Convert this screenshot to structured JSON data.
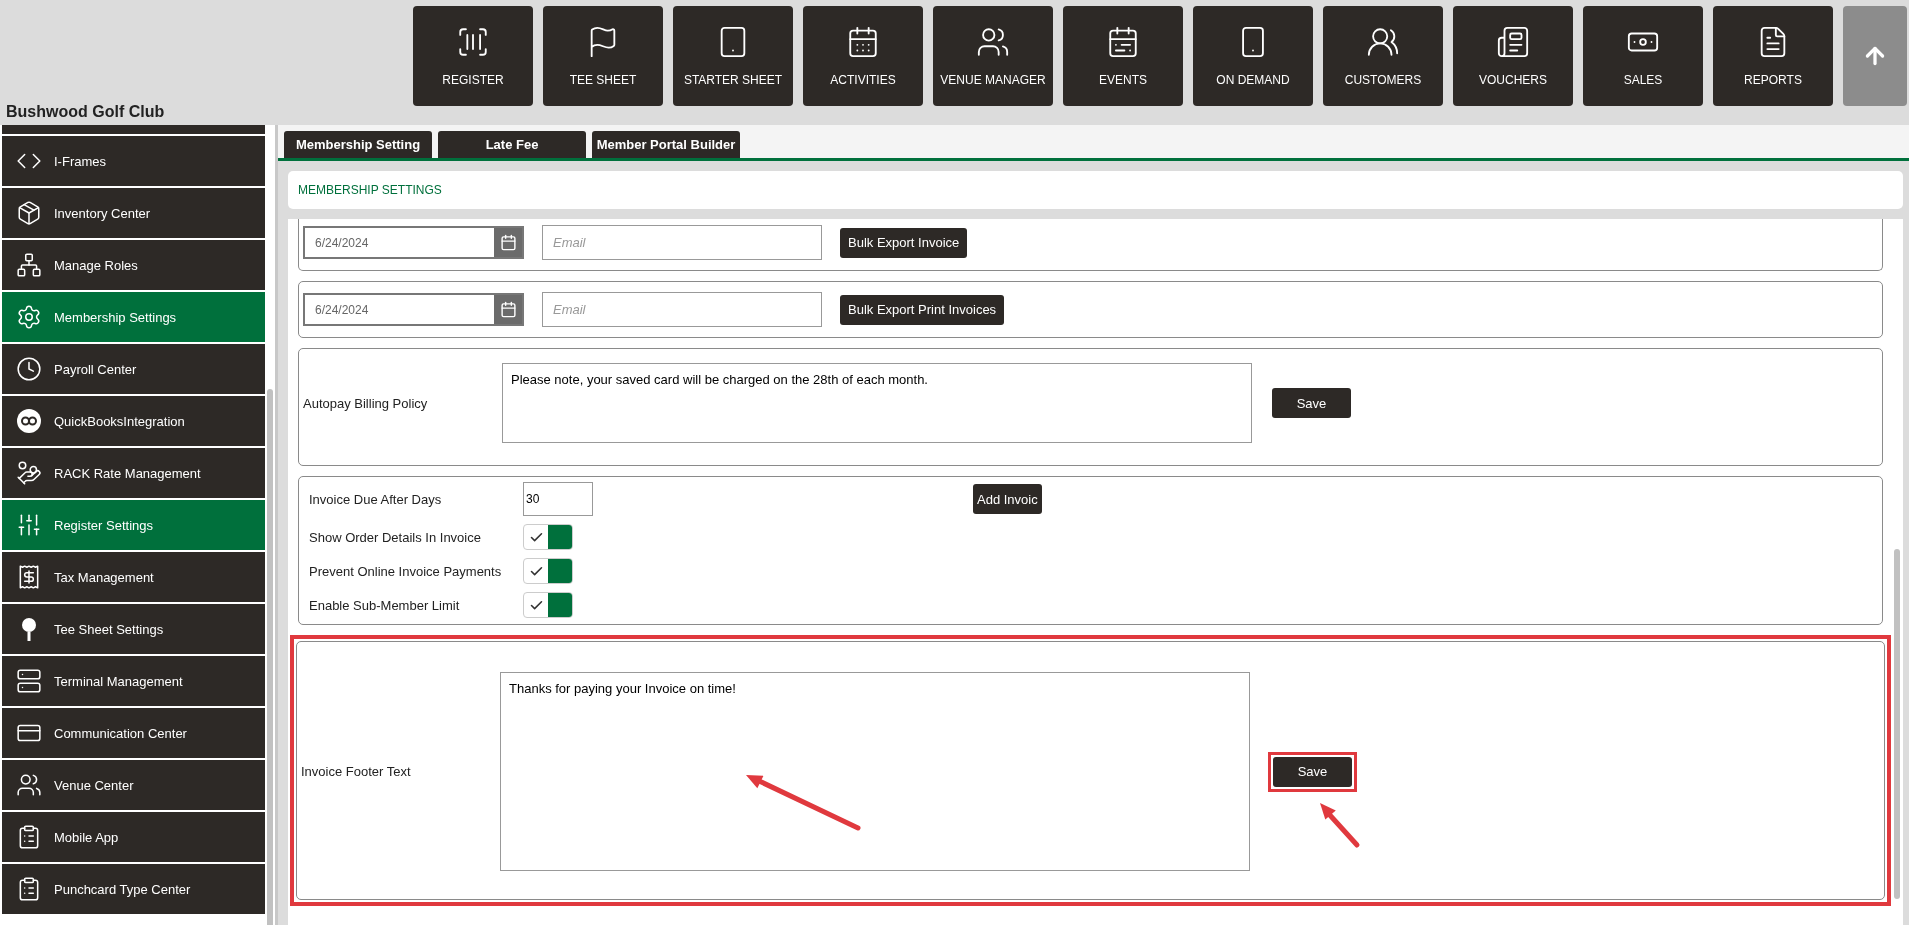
{
  "nav": [
    {
      "label": "REGISTER"
    },
    {
      "label": "TEE SHEET"
    },
    {
      "label": "STARTER SHEET"
    },
    {
      "label": "ACTIVITIES"
    },
    {
      "label": "VENUE MANAGER"
    },
    {
      "label": "EVENTS"
    },
    {
      "label": "ON DEMAND"
    },
    {
      "label": "CUSTOMERS"
    },
    {
      "label": "VOUCHERS"
    },
    {
      "label": "SALES"
    },
    {
      "label": "REPORTS"
    }
  ],
  "club_name": "Bushwood Golf Club",
  "sidebar": {
    "items": [
      {
        "label": "I-Frames",
        "selected": false
      },
      {
        "label": "Inventory Center",
        "selected": false
      },
      {
        "label": "Manage Roles",
        "selected": false
      },
      {
        "label": "Membership Settings",
        "selected": true
      },
      {
        "label": "Payroll Center",
        "selected": false
      },
      {
        "label": "QuickBooksIntegration",
        "selected": false
      },
      {
        "label": "RACK Rate Management",
        "selected": false
      },
      {
        "label": "Register Settings",
        "selected": true
      },
      {
        "label": "Tax Management",
        "selected": false
      },
      {
        "label": "Tee Sheet Settings",
        "selected": false
      },
      {
        "label": "Terminal Management",
        "selected": false
      },
      {
        "label": "Communication Center",
        "selected": false
      },
      {
        "label": "Venue Center",
        "selected": false
      },
      {
        "label": "Mobile App",
        "selected": false
      },
      {
        "label": "Punchcard Type Center",
        "selected": false
      }
    ]
  },
  "tabs": [
    {
      "label": "Membership Setting"
    },
    {
      "label": "Late Fee"
    },
    {
      "label": "Member Portal Builder"
    }
  ],
  "panel_title": "MEMBERSHIP SETTINGS",
  "export_rows": [
    {
      "date": "6/24/2024",
      "email": {
        "placeholder": "Email"
      },
      "button": "Bulk Export Invoice"
    },
    {
      "date": "6/24/2024",
      "email": {
        "placeholder": "Email"
      },
      "button": "Bulk Export Print Invoices"
    }
  ],
  "autopay": {
    "label": "Autopay Billing Policy",
    "text": "Please note, your saved card will be charged on the 28th of each month.",
    "button": "Save"
  },
  "invoice_settings": {
    "due_label": "Invoice Due After Days",
    "due_value": "30",
    "add_button": "Add Invoic",
    "toggles": [
      {
        "label": "Show Order Details In Invoice",
        "on": true
      },
      {
        "label": "Prevent Online Invoice Payments",
        "on": true
      },
      {
        "label": "Enable Sub-Member Limit",
        "on": true
      }
    ]
  },
  "footer": {
    "label": "Invoice Footer Text",
    "text": "Thanks for paying your Invoice on time!",
    "button": "Save"
  }
}
